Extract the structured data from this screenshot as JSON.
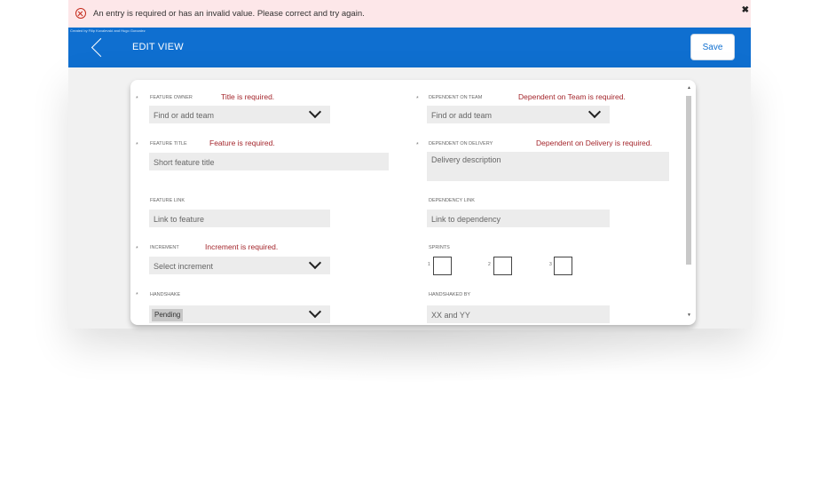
{
  "error_banner": {
    "message": "An entry is required or has an invalid value. Please correct and try again.",
    "close_glyph": "✖",
    "icon": "error-circle-icon"
  },
  "header": {
    "credit": "Created by Filip Kovalevski and Hugo Gonzalez",
    "title": "EDIT VIEW",
    "save_label": "Save",
    "back_icon": "chevron-left-icon"
  },
  "form": {
    "required_mark": "*",
    "feature_owner": {
      "label": "FEATURE OWNER",
      "error": "Title is required.",
      "placeholder": "Find or add team"
    },
    "dependent_on_team": {
      "label": "DEPENDENT ON TEAM",
      "error": "Dependent on Team is required.",
      "placeholder": "Find or add team"
    },
    "feature_title": {
      "label": "FEATURE TITLE",
      "error": "Feature is required.",
      "placeholder": "Short feature title"
    },
    "dependent_on_delivery": {
      "label": "DEPENDENT ON DELIVERY",
      "error": "Dependent on Delivery is required.",
      "placeholder": "Delivery description"
    },
    "feature_link": {
      "label": "FEATURE LINK",
      "placeholder": "Link to feature"
    },
    "dependency_link": {
      "label": "DEPENDENCY LINK",
      "placeholder": "Link to dependency"
    },
    "increment": {
      "label": "INCREMENT",
      "error": "Increment is required.",
      "placeholder": "Select increment"
    },
    "sprints": {
      "label": "SPRINTS",
      "items": [
        "1",
        "2",
        "3"
      ]
    },
    "handshake": {
      "label": "HANDSHAKE",
      "value": "Pending"
    },
    "handshaked_by": {
      "label": "HANDSHAKED BY",
      "placeholder": "XX and YY"
    }
  },
  "colors": {
    "header": "#0f6fd0",
    "error": "#a4262c",
    "banner_bg": "#fde7e9"
  }
}
